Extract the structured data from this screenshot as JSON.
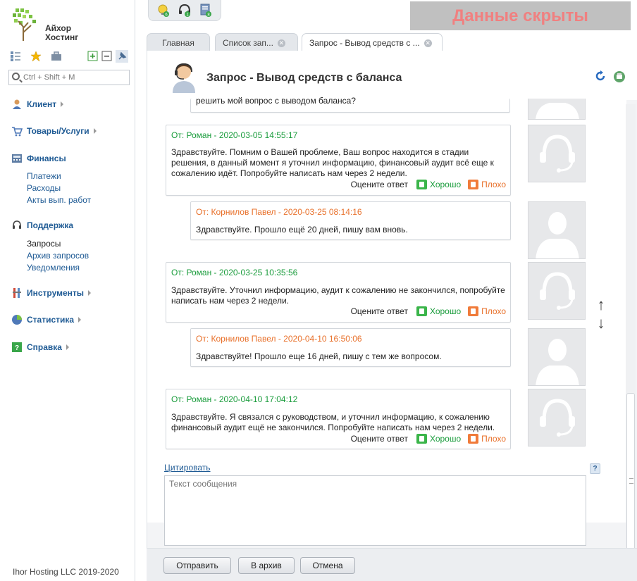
{
  "brand": {
    "line1": "Айхор",
    "line2": "Хостинг"
  },
  "search": {
    "placeholder": "Ctrl + Shift + M"
  },
  "menu": {
    "client": "Клиент",
    "goods": "Товары/Услуги",
    "finance": "Финансы",
    "finance_links": [
      "Платежи",
      "Расходы",
      "Акты вып. работ"
    ],
    "support": "Поддержка",
    "support_links": [
      "Запросы",
      "Архив запросов",
      "Уведомления"
    ],
    "tools": "Инструменты",
    "stats": "Статистика",
    "help": "Справка"
  },
  "copyright": "Ihor Hosting LLC 2019-2020",
  "hidden_banner": "Данные скрыты",
  "tabs": [
    {
      "label": "Главная"
    },
    {
      "label": "Список зап..."
    },
    {
      "label": "Запрос - Вывод средств с ..."
    }
  ],
  "page": {
    "title": "Запрос - Вывод средств с баланса"
  },
  "partial_message": "решить мой вопрос с выводом баланса?",
  "messages": [
    {
      "from": "От: Роман - 2020-03-05 14:55:17",
      "text": "Здравствуйте. Помним о Вашей проблеме, Ваш вопрос находится в стадии решения, в данный момент я уточнил информацию, финансовый аудит всё еще к сожалению идёт. Попробуйте написать нам через 2 недели."
    },
    {
      "from": "От: Корнилов Павел - 2020-03-25 08:14:16",
      "text": "Здравствуйте. Прошло ещё 20 дней, пишу вам вновь."
    },
    {
      "from": "От: Роман - 2020-03-25 10:35:56",
      "text": "Здравствуйте. Уточнил информацию, аудит к сожалению не закончился, попробуйте написать нам через 2 недели."
    },
    {
      "from": "От: Корнилов Павел - 2020-04-10 16:50:06",
      "text": "Здравствуйте! Прошло еще 16 дней, пишу с тем же вопросом."
    },
    {
      "from": "От: Роман - 2020-04-10 17:04:12",
      "text": "Здравствуйте. Я связался с руководством, и уточнил информацию, к сожалению финансовый аудит ещё не закончился. Попробуйте написать нам через 2 недели."
    }
  ],
  "rating": {
    "label": "Оцените ответ",
    "good": "Хорошо",
    "bad": "Плохо"
  },
  "quote_link": "Цитировать",
  "help_mark": "?",
  "reply": {
    "placeholder": "Текст сообщения"
  },
  "buttons": {
    "send": "Отправить",
    "archive": "В архив",
    "cancel": "Отмена"
  },
  "arrows": {
    "up": "↑",
    "down": "↓"
  },
  "colors": {
    "staff": "#1a9c3c",
    "client": "#e8702a",
    "link": "#1e5a94"
  }
}
